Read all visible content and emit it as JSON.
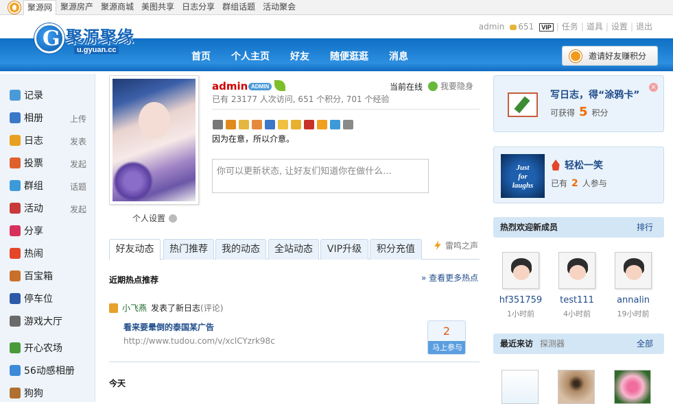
{
  "topbar": {
    "links": [
      "聚源网",
      "聚源房产",
      "聚源商城",
      "美图共享",
      "日志分享",
      "群组话题",
      "活动聚会"
    ]
  },
  "brand": {
    "title": "聚源聚缘",
    "url": "u.gyuan.cc"
  },
  "usernav": {
    "username": "admin",
    "coins": "651",
    "vip": "VIP",
    "items": [
      "任务",
      "道具",
      "设置",
      "退出"
    ]
  },
  "mainnav": [
    "首页",
    "个人主页",
    "好友",
    "随便逛逛",
    "消息"
  ],
  "invite_label": "邀请好友赚积分",
  "sidebar": [
    {
      "label": "记录",
      "action": ""
    },
    {
      "label": "相册",
      "action": "上传"
    },
    {
      "label": "日志",
      "action": "发表"
    },
    {
      "label": "投票",
      "action": "发起"
    },
    {
      "label": "群组",
      "action": "话题"
    },
    {
      "label": "活动",
      "action": "发起"
    },
    {
      "label": "分享",
      "action": ""
    },
    {
      "label": "热闹",
      "action": ""
    },
    {
      "label": "百宝箱",
      "action": ""
    },
    {
      "label": "停车位",
      "action": ""
    },
    {
      "label": "游戏大厅",
      "action": ""
    },
    {
      "label": "开心农场",
      "action": ""
    },
    {
      "label": "56动感相册",
      "action": ""
    },
    {
      "label": "狗狗",
      "action": ""
    }
  ],
  "profile": {
    "name": "admin",
    "badge": "ADMIN",
    "online": "当前在线",
    "hide": "我要隐身",
    "stats": "已有 23177 人次访问, 651 个积分, 701 个经验",
    "motto": "因为在意，所以介意。",
    "settings": "个人设置",
    "status_placeholder": "你可以更新状态, 让好友们知道你在做什么..."
  },
  "tabs": [
    "好友动态",
    "热门推荐",
    "我的动态",
    "全站动态",
    "VIP升级",
    "积分充值"
  ],
  "tab_extra": "雷鸣之声",
  "feed": {
    "hot_title": "近期热点推荐",
    "more": "» 查看更多热点",
    "user": "小飞燕",
    "action": "发表了新日志",
    "comment": "(评论)",
    "title": "看来要晕倒的泰国某广告",
    "url": "http://www.tudou.com/v/xclCYzrk98c",
    "vote_count": "2",
    "vote_label": "马上参与",
    "today": "今天"
  },
  "diary_card": {
    "title": "写日志，得“涂鸦卡”",
    "prefix": "可获得",
    "points": "5",
    "suffix": "积分"
  },
  "relax_card": {
    "badge": "Just for laughs 轻松一笑",
    "title": "轻松一笑",
    "prefix": "已有",
    "count": "2",
    "suffix": "人参与"
  },
  "members": {
    "title": "热烈欢迎新成员",
    "rank": "排行",
    "list": [
      {
        "name": "hf351759",
        "time": "1小时前"
      },
      {
        "name": "test111",
        "time": "4小时前"
      },
      {
        "name": "annalin",
        "time": "19小时前"
      }
    ]
  },
  "visitors": {
    "title": "最近来访",
    "detector": "探测器",
    "all": "全部"
  }
}
